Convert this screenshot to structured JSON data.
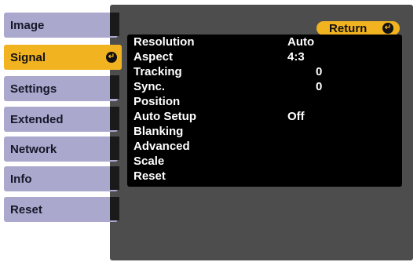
{
  "sidebar": {
    "items": [
      {
        "label": "Image",
        "selected": false
      },
      {
        "label": "Signal",
        "selected": true
      },
      {
        "label": "Settings",
        "selected": false
      },
      {
        "label": "Extended",
        "selected": false
      },
      {
        "label": "Network",
        "selected": false
      },
      {
        "label": "Info",
        "selected": false
      },
      {
        "label": "Reset",
        "selected": false
      }
    ],
    "selected_icon": "enter-arrow-icon"
  },
  "panel": {
    "return_label": "Return",
    "return_icon": "enter-arrow-icon",
    "items": [
      {
        "label": "Resolution",
        "value": "Auto"
      },
      {
        "label": "Aspect",
        "value": "4:3"
      },
      {
        "label": "Tracking",
        "value": "0"
      },
      {
        "label": "Sync.",
        "value": "0"
      },
      {
        "label": "Position",
        "value": ""
      },
      {
        "label": "Auto Setup",
        "value": "Off"
      },
      {
        "label": "Blanking",
        "value": ""
      },
      {
        "label": "Advanced",
        "value": ""
      },
      {
        "label": "Scale",
        "value": ""
      },
      {
        "label": "Reset",
        "value": ""
      }
    ]
  },
  "colors": {
    "accent": "#f2b320",
    "sidebar_item": "#aaa8cc",
    "panel": "#4d4d4d",
    "list_bg": "#000000"
  }
}
